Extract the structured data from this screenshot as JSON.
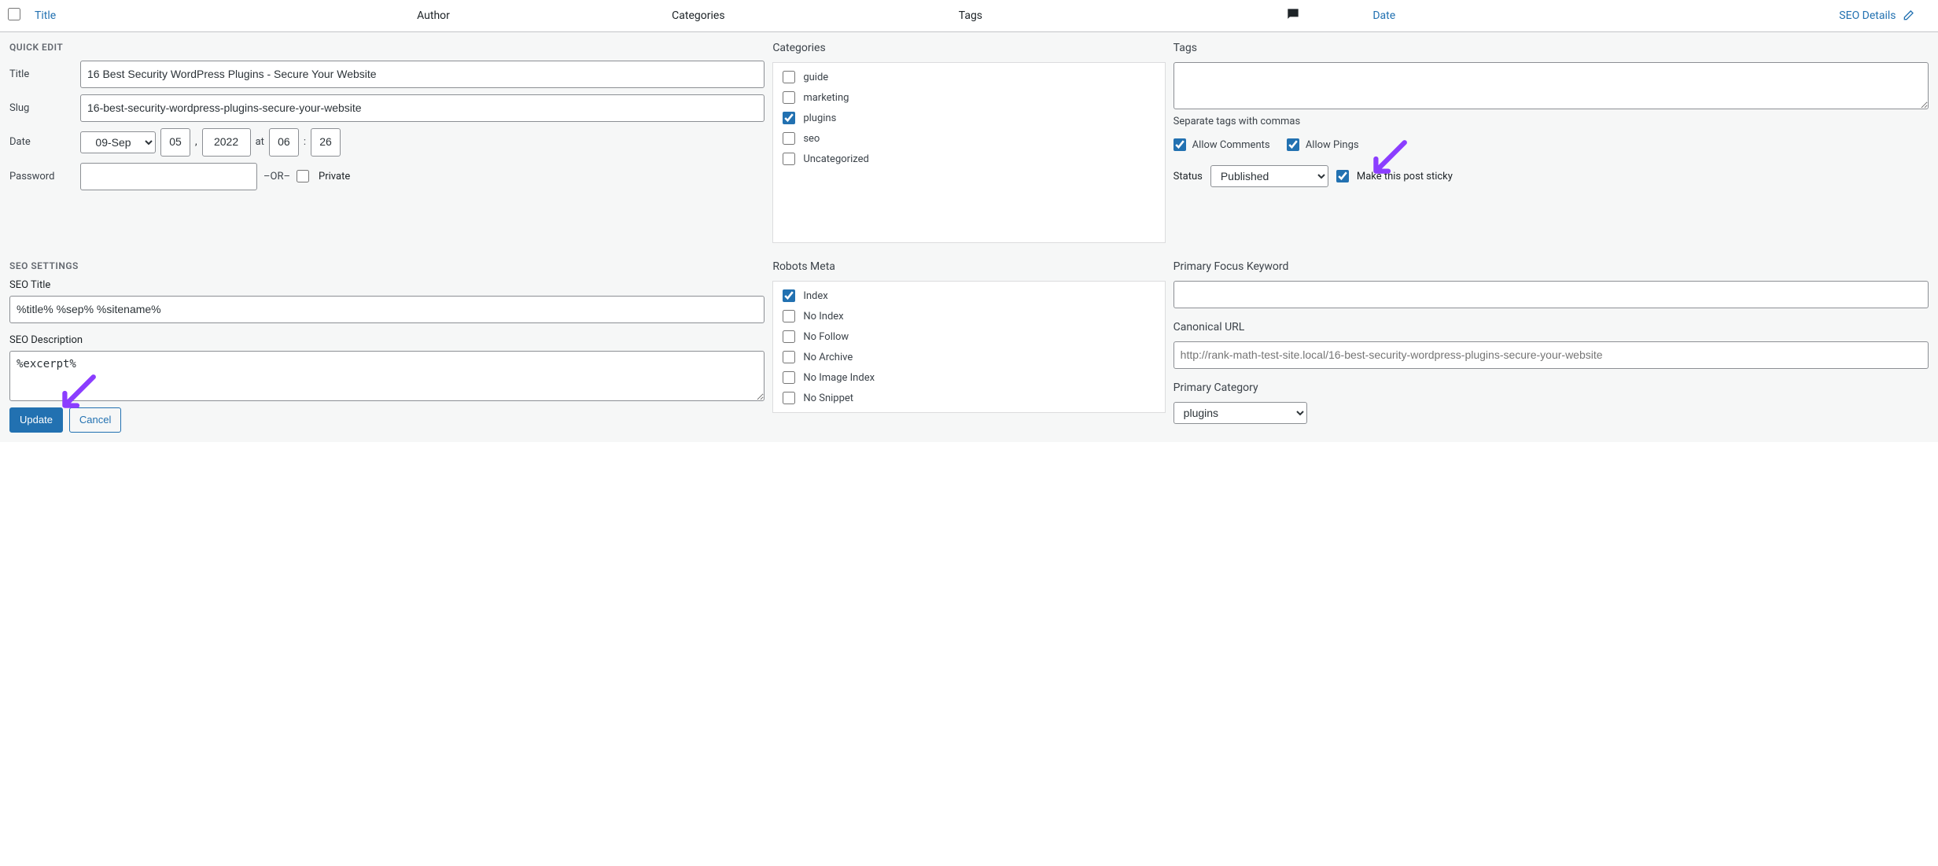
{
  "table_header": {
    "title": "Title",
    "author": "Author",
    "categories": "Categories",
    "tags": "Tags",
    "date": "Date",
    "seo_details": "SEO Details"
  },
  "quick_edit": {
    "heading": "QUICK EDIT",
    "title_label": "Title",
    "title_value": "16 Best Security WordPress Plugins - Secure Your Website",
    "slug_label": "Slug",
    "slug_value": "16-best-security-wordpress-plugins-secure-your-website",
    "date_label": "Date",
    "month_value": "09-Sep",
    "day_value": "05",
    "year_value": "2022",
    "at_text": "at",
    "hour_value": "06",
    "colon": ":",
    "minute_value": "26",
    "password_label": "Password",
    "password_value": "",
    "or_text": "–OR–",
    "private_label": "Private"
  },
  "categories": {
    "heading": "Categories",
    "items": [
      {
        "label": "guide",
        "checked": false
      },
      {
        "label": "marketing",
        "checked": false
      },
      {
        "label": "plugins",
        "checked": true
      },
      {
        "label": "seo",
        "checked": false
      },
      {
        "label": "Uncategorized",
        "checked": false
      }
    ]
  },
  "tags": {
    "heading": "Tags",
    "value": "",
    "hint": "Separate tags with commas",
    "allow_comments_label": "Allow Comments",
    "allow_comments_checked": true,
    "allow_pings_label": "Allow Pings",
    "allow_pings_checked": true,
    "status_label": "Status",
    "status_value": "Published",
    "sticky_label": "Make this post sticky",
    "sticky_checked": true
  },
  "seo": {
    "heading": "SEO SETTINGS",
    "seo_title_label": "SEO Title",
    "seo_title_value": "%title% %sep% %sitename%",
    "seo_desc_label": "SEO Description",
    "seo_desc_value": "%excerpt%"
  },
  "robots": {
    "heading": "Robots Meta",
    "items": [
      {
        "label": "Index",
        "checked": true
      },
      {
        "label": "No Index",
        "checked": false
      },
      {
        "label": "No Follow",
        "checked": false
      },
      {
        "label": "No Archive",
        "checked": false
      },
      {
        "label": "No Image Index",
        "checked": false
      },
      {
        "label": "No Snippet",
        "checked": false
      }
    ]
  },
  "rank": {
    "focus_label": "Primary Focus Keyword",
    "focus_value": "",
    "canonical_label": "Canonical URL",
    "canonical_placeholder": "http://rank-math-test-site.local/16-best-security-wordpress-plugins-secure-your-website",
    "primary_cat_label": "Primary Category",
    "primary_cat_value": "plugins"
  },
  "buttons": {
    "update": "Update",
    "cancel": "Cancel"
  },
  "_annotation_arrows": {
    "color": "#8b3dff"
  },
  "comma": ","
}
